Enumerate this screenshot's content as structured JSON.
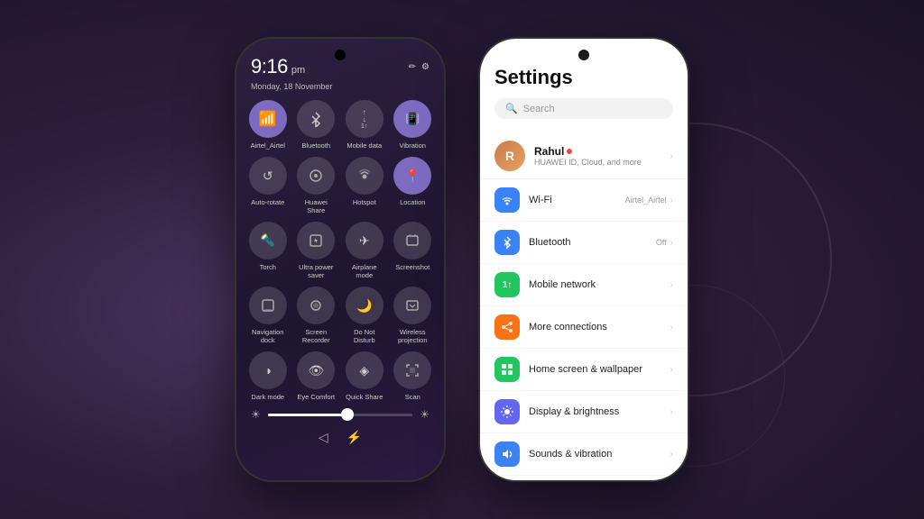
{
  "background": {
    "color": "#3d2d4e"
  },
  "left_phone": {
    "time": "9:16",
    "ampm": "pm",
    "date": "Monday, 18 November",
    "edit_icon": "✏",
    "settings_icon": "⚙",
    "tiles": [
      {
        "id": "wifi",
        "label": "Airtel_Airtel",
        "icon": "📶",
        "active": true
      },
      {
        "id": "bluetooth",
        "label": "Bluetooth",
        "icon": "⬡",
        "active": false
      },
      {
        "id": "mobile-data",
        "label": "Mobile data",
        "icon": "↑↓",
        "active": false
      },
      {
        "id": "vibration",
        "label": "Vibration",
        "icon": "📳",
        "active": true
      },
      {
        "id": "auto-rotate",
        "label": "Auto-rotate",
        "icon": "↺",
        "active": false
      },
      {
        "id": "huawei-share",
        "label": "Huawei Share",
        "icon": "◎",
        "active": false
      },
      {
        "id": "hotspot",
        "label": "Hotspot",
        "icon": "⊕",
        "active": false
      },
      {
        "id": "location",
        "label": "Location",
        "icon": "📍",
        "active": true
      },
      {
        "id": "torch",
        "label": "Torch",
        "icon": "🔦",
        "active": false
      },
      {
        "id": "ultra-power",
        "label": "Ultra power saver",
        "icon": "⊡",
        "active": false
      },
      {
        "id": "airplane",
        "label": "Airplane mode",
        "icon": "✈",
        "active": false
      },
      {
        "id": "screenshot",
        "label": "Screenshot",
        "icon": "⬚",
        "active": false
      },
      {
        "id": "nav-dock",
        "label": "Navigation dock",
        "icon": "⊞",
        "active": false
      },
      {
        "id": "screen-rec",
        "label": "Screen Recorder",
        "icon": "⊙",
        "active": false
      },
      {
        "id": "dnd",
        "label": "Do Not Disturb",
        "icon": "🌙",
        "active": false
      },
      {
        "id": "wireless",
        "label": "Wireless projection",
        "icon": "⊟",
        "active": false
      },
      {
        "id": "dark-mode",
        "label": "Dark mode",
        "icon": "◑",
        "active": false
      },
      {
        "id": "eye-comfort",
        "label": "Eye Comfort",
        "icon": "👁",
        "active": false
      },
      {
        "id": "quick-share",
        "label": "Quick Share",
        "icon": "◈",
        "active": false
      },
      {
        "id": "scan",
        "label": "Scan",
        "icon": "⊡",
        "active": false
      }
    ],
    "brightness_pct": 55,
    "bottom_nav": [
      "◁",
      "⚡"
    ]
  },
  "right_phone": {
    "title": "Settings",
    "search_placeholder": "Search",
    "profile": {
      "name": "Rahul",
      "sub": "HUAWEI ID, Cloud, and more"
    },
    "items": [
      {
        "id": "wifi",
        "label": "Wi-Fi",
        "value": "Airtel_Airtel",
        "icon": "📶",
        "icon_class": "ic-wifi"
      },
      {
        "id": "bluetooth",
        "label": "Bluetooth",
        "value": "Off",
        "icon": "⬡",
        "icon_class": "ic-bt"
      },
      {
        "id": "mobile-network",
        "label": "Mobile network",
        "value": "",
        "icon": "①①",
        "icon_class": "ic-mobile"
      },
      {
        "id": "more-connections",
        "label": "More connections",
        "value": "",
        "icon": "⋯",
        "icon_class": "ic-connect"
      },
      {
        "id": "home-screen",
        "label": "Home screen & wallpaper",
        "value": "",
        "icon": "⊞",
        "icon_class": "ic-home"
      },
      {
        "id": "display",
        "label": "Display & brightness",
        "value": "",
        "icon": "☀",
        "icon_class": "ic-display"
      },
      {
        "id": "sound",
        "label": "Sounds & vibration",
        "value": "",
        "icon": "🔊",
        "icon_class": "ic-sound"
      }
    ]
  }
}
